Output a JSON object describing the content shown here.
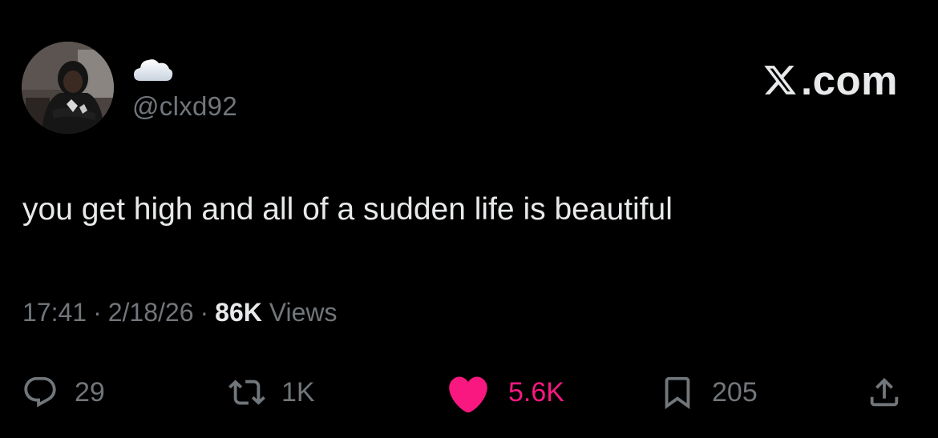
{
  "author": {
    "display_name_icon": "cloud-emoji",
    "handle": "@clxd92",
    "avatar_icon": "profile-photo"
  },
  "brand": {
    "logo_icon": "x-logo-icon",
    "label": ".com"
  },
  "post": {
    "text": "you get high and all of a sudden life is beautiful"
  },
  "meta": {
    "time": "17:41",
    "separator": "·",
    "date": "2/18/26",
    "views_count": "86K",
    "views_label": "Views"
  },
  "actions": {
    "reply": {
      "icon": "reply-icon",
      "count": "29"
    },
    "repost": {
      "icon": "repost-icon",
      "count": "1K"
    },
    "like": {
      "icon": "heart-icon",
      "count": "5.6K",
      "active": true
    },
    "bookmark": {
      "icon": "bookmark-icon",
      "count": "205"
    },
    "share": {
      "icon": "share-icon"
    }
  },
  "colors": {
    "background": "#000000",
    "primary_text": "#e7e9ea",
    "secondary_text": "#71767b",
    "like_accent": "#f91880"
  }
}
